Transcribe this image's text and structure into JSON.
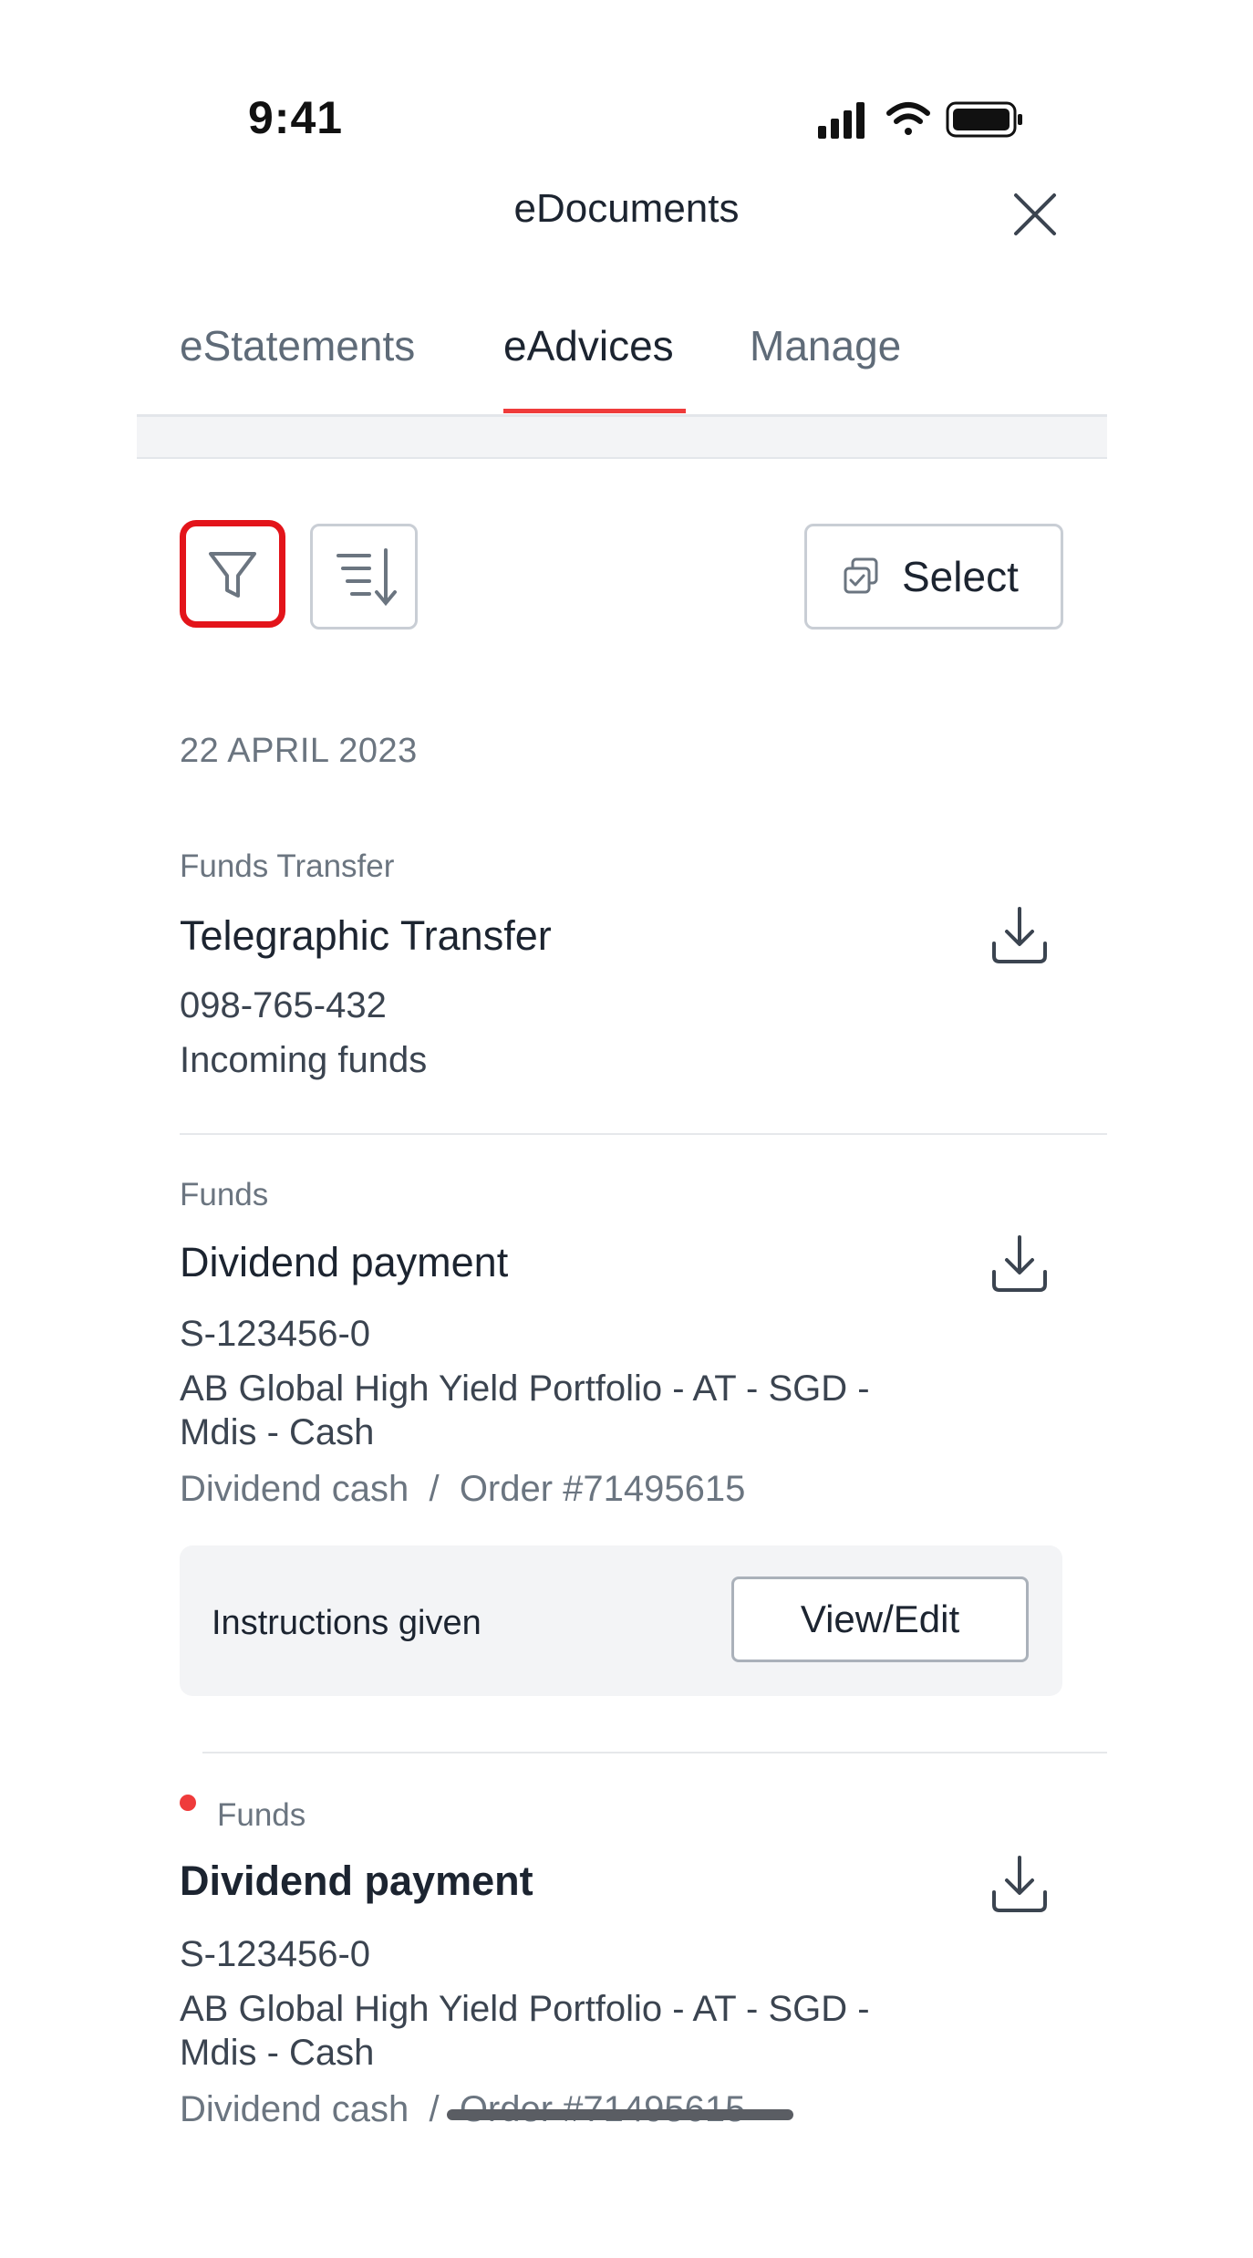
{
  "status_bar": {
    "time": "9:41"
  },
  "header": {
    "title": "eDocuments"
  },
  "tabs": [
    {
      "label": "eStatements"
    },
    {
      "label": "eAdvices"
    },
    {
      "label": "Manage"
    }
  ],
  "toolbar": {
    "select_label": "Select"
  },
  "date_heading": "22 APRIL 2023",
  "items": [
    {
      "category": "Funds Transfer",
      "title": "Telegraphic Transfer",
      "reference": "098-765-432",
      "description": "Incoming funds"
    },
    {
      "category": "Funds",
      "title": "Dividend payment",
      "reference": "S-123456-0",
      "fund_line1": "AB Global High Yield Portfolio - AT - SGD -",
      "fund_line2": "Mdis - Cash",
      "detail": "Dividend cash  /  Order #71495615",
      "instructions_label": "Instructions given",
      "action_label": "View/Edit"
    },
    {
      "category": "Funds",
      "title": "Dividend payment",
      "reference": "S-123456-0",
      "fund_line1": "AB Global High Yield Portfolio - AT - SGD -",
      "fund_line2": "Mdis - Cash",
      "detail": "Dividend cash  /  Order #71495615",
      "unread": true
    }
  ],
  "colors": {
    "accent": "#ef3b3b",
    "highlight": "#e3141a",
    "text": "#1c2430",
    "muted": "#6b7580"
  }
}
